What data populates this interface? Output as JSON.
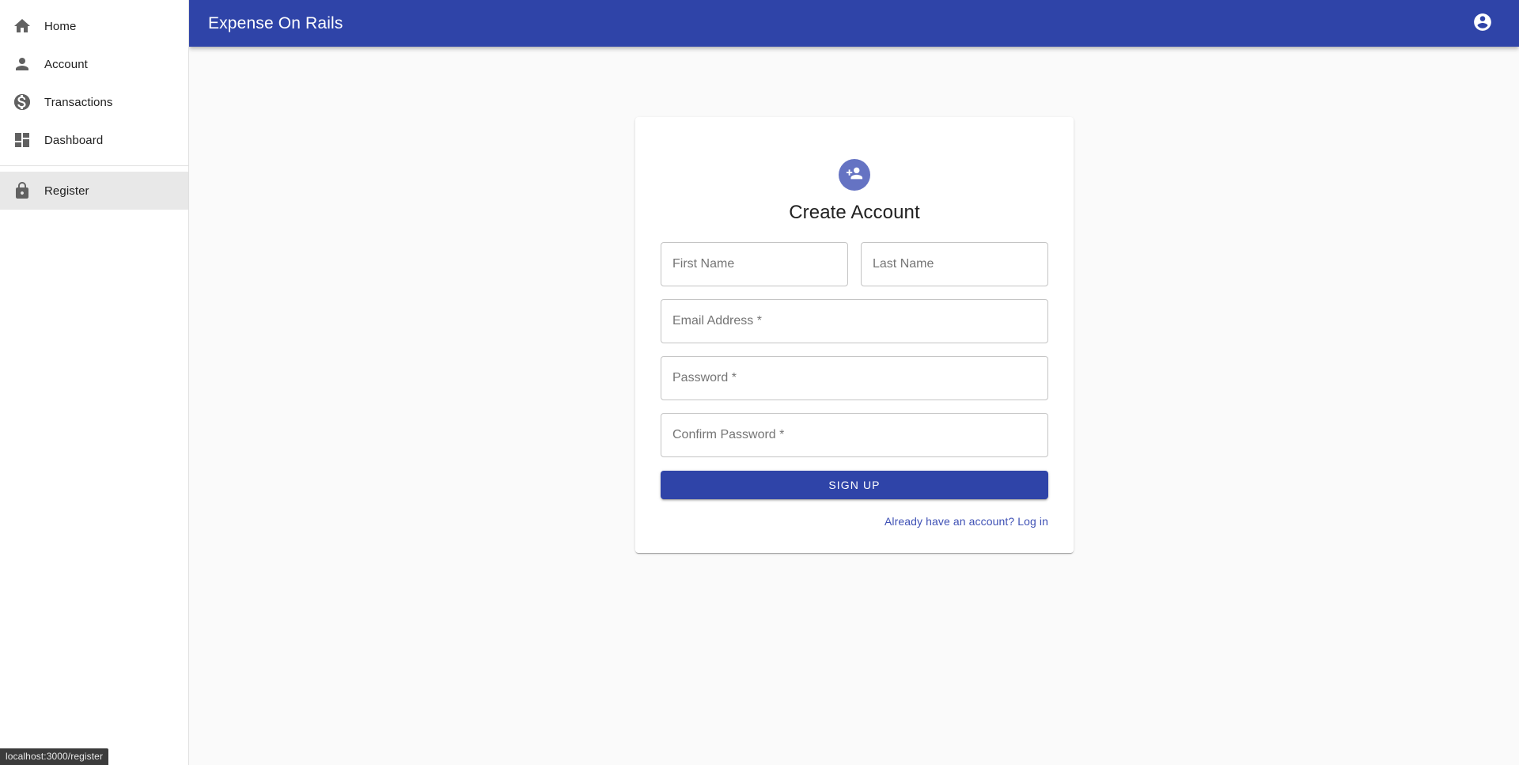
{
  "appbar": {
    "title": "Expense On Rails",
    "account_icon": "account-circle-icon",
    "background": "#2f44a8"
  },
  "sidebar": {
    "items": [
      {
        "label": "Home",
        "icon": "home-icon",
        "selected": false
      },
      {
        "label": "Account",
        "icon": "person-icon",
        "selected": false
      },
      {
        "label": "Transactions",
        "icon": "monetization-on-icon",
        "selected": false
      },
      {
        "label": "Dashboard",
        "icon": "dashboard-icon",
        "selected": false
      }
    ],
    "bottom_items": [
      {
        "label": "Register",
        "icon": "lock-icon",
        "selected": true
      }
    ],
    "selected_background": "#e8e8e8"
  },
  "card": {
    "avatar_icon": "person-add-icon",
    "avatar_color": "#6573c3",
    "title": "Create Account",
    "fields": [
      {
        "name": "first-name",
        "placeholder": "First Name",
        "value": "",
        "type": "text"
      },
      {
        "name": "last-name",
        "placeholder": "Last Name",
        "value": "",
        "type": "text"
      },
      {
        "name": "email",
        "placeholder": "Email Address *",
        "value": "",
        "type": "text"
      },
      {
        "name": "password",
        "placeholder": "Password *",
        "value": "",
        "type": "password"
      },
      {
        "name": "confirm-password",
        "placeholder": "Confirm Password *",
        "value": "",
        "type": "password"
      }
    ],
    "submit_label": "SIGN UP",
    "submit_color": "#2f44a8",
    "login_link": "Already have an account? Log in",
    "login_link_color": "#3f51b5"
  },
  "statusbar": {
    "url": "localhost:3000/register"
  }
}
